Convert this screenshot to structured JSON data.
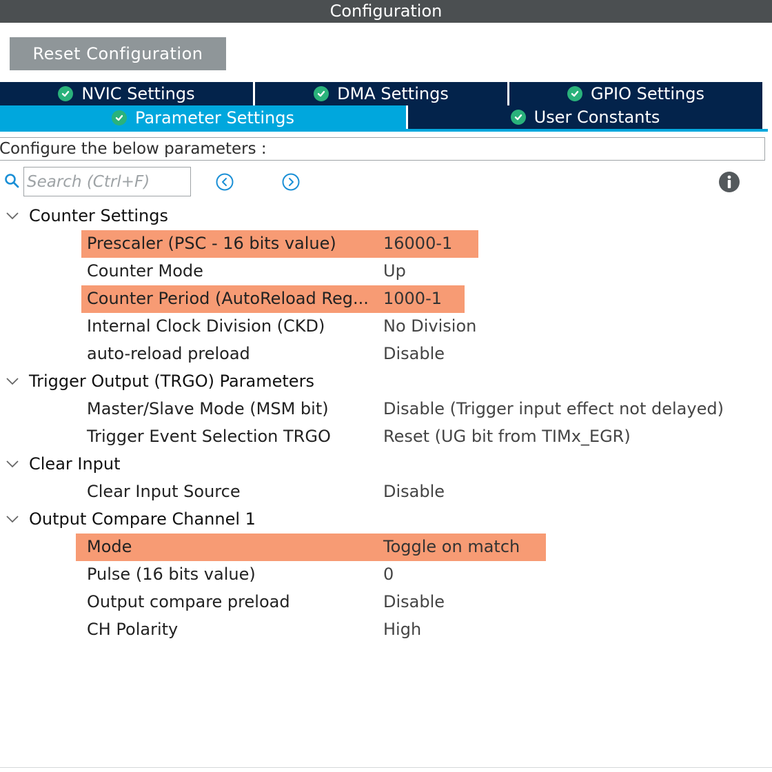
{
  "window": {
    "title": "Configuration"
  },
  "toolbar": {
    "reset_label": "Reset Configuration"
  },
  "tabs": [
    {
      "label": "NVIC Settings",
      "icon": "check-circle-icon",
      "active": false
    },
    {
      "label": "DMA Settings",
      "icon": "check-circle-icon",
      "active": false
    },
    {
      "label": "GPIO Settings",
      "icon": "check-circle-icon",
      "active": false
    },
    {
      "label": "Parameter Settings",
      "icon": "check-circle-icon",
      "active": true
    },
    {
      "label": "User Constants",
      "icon": "check-circle-icon",
      "active": false
    }
  ],
  "description": "Configure the below parameters :",
  "search": {
    "placeholder": "Search (Ctrl+F)",
    "value": ""
  },
  "groups": [
    {
      "label": "Counter Settings",
      "params": [
        {
          "name": "Prescaler (PSC - 16 bits value)",
          "value": "16000-1",
          "highlighted": true
        },
        {
          "name": "Counter Mode",
          "value": "Up",
          "highlighted": false
        },
        {
          "name": "Counter Period (AutoReload Reg...",
          "value": "1000-1",
          "highlighted": true
        },
        {
          "name": "Internal Clock Division (CKD)",
          "value": "No Division",
          "highlighted": false
        },
        {
          "name": "auto-reload preload",
          "value": "Disable",
          "highlighted": false
        }
      ]
    },
    {
      "label": "Trigger Output (TRGO) Parameters",
      "params": [
        {
          "name": "Master/Slave Mode (MSM bit)",
          "value": "Disable (Trigger input effect not delayed)",
          "highlighted": false
        },
        {
          "name": "Trigger Event Selection TRGO",
          "value": "Reset (UG bit from TIMx_EGR)",
          "highlighted": false
        }
      ]
    },
    {
      "label": "Clear Input",
      "params": [
        {
          "name": "Clear Input Source",
          "value": "Disable",
          "highlighted": false
        }
      ]
    },
    {
      "label": "Output Compare Channel 1",
      "params": [
        {
          "name": "Mode",
          "value": "Toggle on match",
          "highlighted": true
        },
        {
          "name": "Pulse (16 bits value)",
          "value": "0",
          "highlighted": false
        },
        {
          "name": "Output compare preload",
          "value": "Disable",
          "highlighted": false
        },
        {
          "name": "CH Polarity",
          "value": "High",
          "highlighted": false
        }
      ]
    }
  ],
  "colors": {
    "title_bar": "#4b4f51",
    "tab_dark": "#03234b",
    "tab_active": "#00a7dd",
    "check": "#2ab27b",
    "highlight": "#f79b74",
    "reset_button": "#8f9699"
  }
}
